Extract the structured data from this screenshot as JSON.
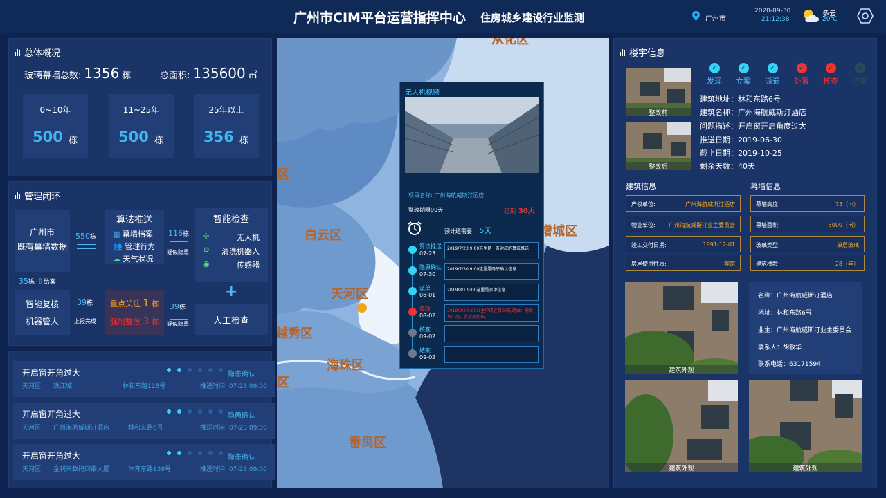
{
  "header": {
    "title": "广州市CIM平台运营指挥中心",
    "subtitle": "住房城乡建设行业监测",
    "city": "广州市",
    "date": "2020-09-30",
    "time": "21:12:38",
    "weather": "多云",
    "temperature": "20℃"
  },
  "overview": {
    "title": "总体概况",
    "total_label": "玻璃幕墙总数:",
    "total_value": "1356",
    "total_unit": "栋",
    "area_label": "总面积:",
    "area_value": "135600",
    "area_unit": "㎡",
    "categories": [
      {
        "label": "0~10年",
        "value": "500",
        "unit": "栋"
      },
      {
        "label": "11~25年",
        "value": "500",
        "unit": "栋"
      },
      {
        "label": "25年以上",
        "value": "356",
        "unit": "栋"
      }
    ]
  },
  "loop": {
    "title": "管理闭环",
    "source_line1": "广州市",
    "source_line2": "既有幕墙数据",
    "arrow1_value": "550",
    "arrow1_unit": "栋",
    "algo_title": "算法推送",
    "algo_items": [
      "幕墙档案",
      "管理行为",
      "天气状况"
    ],
    "arrow2_value": "116",
    "arrow2_unit": "栋",
    "arrow2_label": "疑似隐患",
    "inspect_title": "智能检查",
    "inspect_items": [
      "无人机",
      "清洗机器人",
      "传感器"
    ],
    "manual_label": "人工检查",
    "arrow3_value": "39",
    "arrow3_unit": "栋",
    "arrow3_label": "疑似隐患",
    "focus_label": "重点关注",
    "focus_value": "1",
    "focus_unit": "栋",
    "force_label": "强制整改",
    "force_value": "3",
    "force_unit": "栋",
    "arrow4_value": "39",
    "arrow4_unit": "栋",
    "arrow4_label": "上报完成",
    "review_line1": "智能复核",
    "review_line2": "机器管人",
    "closed_value": "35",
    "closed_unit": "栋",
    "closed_label": "结案"
  },
  "cards": [
    {
      "title": "开启窗开角过大",
      "status": "隐患确认",
      "district": "天河区",
      "building": "珠江城",
      "address": "林和东路128号",
      "time": "推送时间: 07-23 09:00",
      "progress": 2,
      "steps": 6
    },
    {
      "title": "开启窗开角过大",
      "status": "隐患确认",
      "district": "天河区",
      "building": "广州海航威斯汀酒店",
      "address": "林和东路6号",
      "time": "推送时间: 07-23 09:00",
      "progress": 2,
      "steps": 6
    },
    {
      "title": "开启窗开角过大",
      "status": "隐患确认",
      "district": "天河区",
      "building": "金利来数码网络大厦",
      "address": "体育东路138号",
      "time": "推送时间: 07-23 09:00",
      "progress": 2,
      "steps": 6
    }
  ],
  "map": {
    "labels": [
      "从化区",
      "区",
      "白云区",
      "增城区",
      "天河区",
      "越秀区",
      "海珠区",
      "区",
      "番禺区"
    ]
  },
  "popup": {
    "title": "无人机视频",
    "project_label": "项目名称:",
    "project_name": "广州海航威斯汀酒店",
    "period_label": "整改期限90天",
    "overdue_label": "延期",
    "overdue_value": "30天",
    "remaining_label": "预计还需要",
    "remaining_value": "5天",
    "timeline": [
      {
        "name": "算法推送",
        "date": "07-23",
        "text": "2019/7/23 9:00这里是一条对应的算法推送",
        "state": "done"
      },
      {
        "name": "隐患确认",
        "date": "07-30",
        "text": "2019/7/30 9:00这里是隐患确认信息",
        "state": "done"
      },
      {
        "name": "派单",
        "date": "08-01",
        "text": "2019/8/1 9:00这里是派单信息",
        "state": "done"
      },
      {
        "name": "整改",
        "date": "08-02",
        "text": "2019/8/2 9:00业主申请延期30天,理由：需联系厂商，供货周期长。",
        "state": "alert"
      },
      {
        "name": "核查",
        "date": "09-02",
        "text": "",
        "state": "pending"
      },
      {
        "name": "结案",
        "date": "09-02",
        "text": "",
        "state": "pending"
      }
    ]
  },
  "building": {
    "title": "楼宇信息",
    "before_label": "整改前",
    "after_label": "整改后",
    "steps": [
      {
        "label": "发现",
        "state": "done"
      },
      {
        "label": "立案",
        "state": "done"
      },
      {
        "label": "派遣",
        "state": "done"
      },
      {
        "label": "处置",
        "state": "alert"
      },
      {
        "label": "核查",
        "state": "alert"
      },
      {
        "label": "结案",
        "state": "pending"
      }
    ],
    "address": "建筑地址：林和东路6号",
    "name": "建筑名称：广州海航威斯汀酒店",
    "problem": "问题描述：开启窗开启角度过大",
    "push_date": "推送日期：2019-06-30",
    "deadline": "截止日期：2019-10-25",
    "remaining": "剩余天数：40天",
    "info_title": "建筑信息",
    "wall_title": "幕墙信息",
    "info": [
      {
        "k": "产权单位:",
        "v": "广州海航威斯汀酒店"
      },
      {
        "k": "物业单位:",
        "v": "广州海航威斯汀业主委员会"
      },
      {
        "k": "竣工交付日期:",
        "v": "1991-12-01"
      },
      {
        "k": "房屋使用性质:",
        "v": "宾馆"
      }
    ],
    "wall": [
      {
        "k": "幕墙高度:",
        "v": "75（m）"
      },
      {
        "k": "幕墙面积:",
        "v": "5000（㎡）"
      },
      {
        "k": "玻璃类型:",
        "v": "单层玻璃"
      },
      {
        "k": "建筑楼龄:",
        "v": "28（年）"
      }
    ],
    "photo_caption": "建筑外观",
    "detail": {
      "name": "名称：广州海航威斯汀酒店",
      "address": "地址：林和东路6号",
      "owner": "业主：广州海航威斯汀业主委员会",
      "contact": "联系人：胡敏华",
      "phone": "联系电话：63171594"
    }
  },
  "colors": {
    "accent": "#41b5ee",
    "alert": "#e33333",
    "warn": "#f5a623",
    "panel": "#1a3467"
  }
}
